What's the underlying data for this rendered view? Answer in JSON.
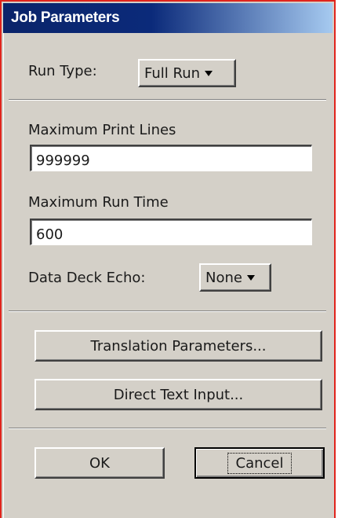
{
  "window": {
    "title": "Job Parameters"
  },
  "run_type": {
    "label": "Run Type:",
    "selected": "Full Run"
  },
  "max_print_lines": {
    "label": "Maximum Print Lines",
    "value": "999999"
  },
  "max_run_time": {
    "label": "Maximum Run Time",
    "value": "600"
  },
  "data_deck_echo": {
    "label": "Data Deck Echo:",
    "selected": "None"
  },
  "buttons": {
    "translation_parameters": "Translation Parameters...",
    "direct_text_input": "Direct Text Input...",
    "ok": "OK",
    "cancel": "Cancel"
  },
  "colors": {
    "title_bar_start": "#0a246a",
    "title_bar_end": "#a6caf0",
    "dialog_face": "#d4d0c8",
    "window_border": "#e0241c"
  },
  "icons": {
    "dropdown_arrow": "triangle-down"
  }
}
